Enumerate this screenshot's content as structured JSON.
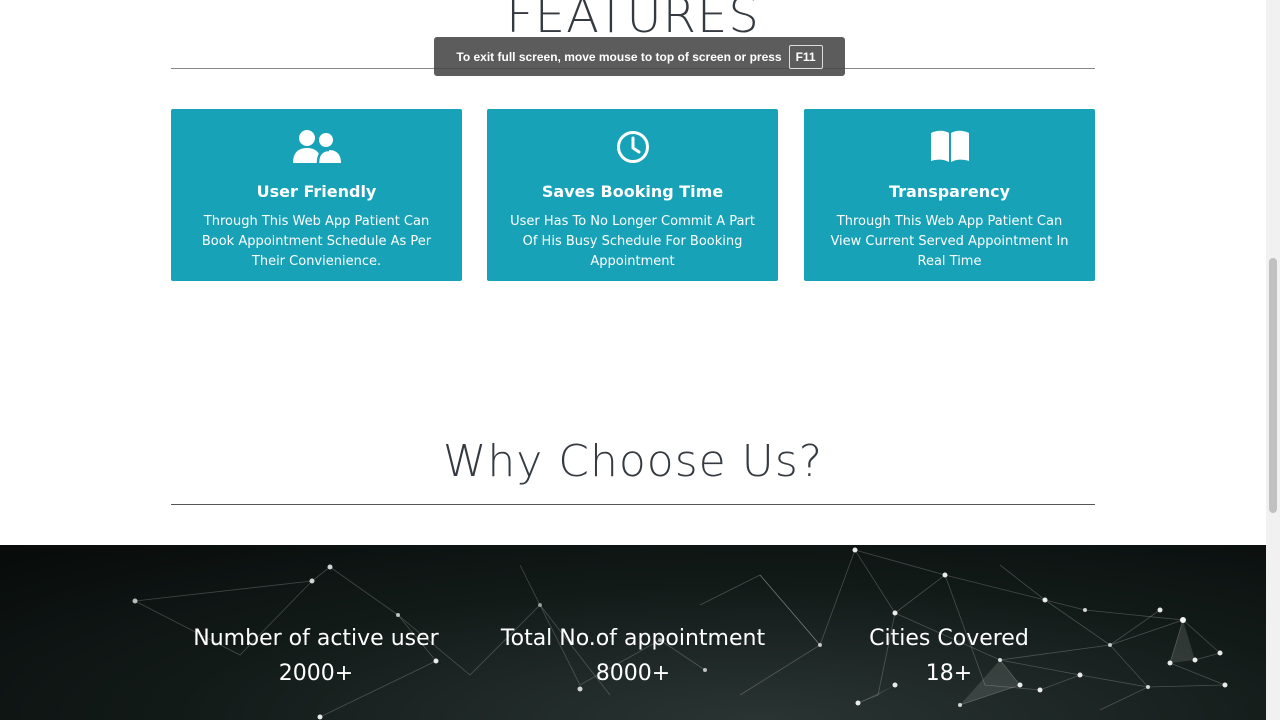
{
  "features": {
    "title": "FEATURES",
    "cards": [
      {
        "icon": "users-icon",
        "title": "User Friendly",
        "text": "Through This Web App Patient Can Book Appointment Schedule As Per Their Convienience."
      },
      {
        "icon": "clock-icon",
        "title": "Saves Booking Time",
        "text": "User Has To No Longer Commit A Part Of His Busy Schedule For Booking Appointment"
      },
      {
        "icon": "book-open-icon",
        "title": "Transparency",
        "text": "Through This Web App Patient Can View Current Served Appointment In Real Time"
      }
    ]
  },
  "why": {
    "title": "Why Choose Us?",
    "stats": [
      {
        "label": "Number of active user",
        "value": "2000+"
      },
      {
        "label": "Total No.of appointment",
        "value": "8000+"
      },
      {
        "label": "Cities Covered",
        "value": "18+"
      }
    ]
  },
  "fullscreen_notice": {
    "text": "To exit full screen, move mouse to top of screen or press",
    "key": "F11"
  },
  "colors": {
    "card_bg": "#17a2b8",
    "stats_bg": "#0d1412"
  }
}
